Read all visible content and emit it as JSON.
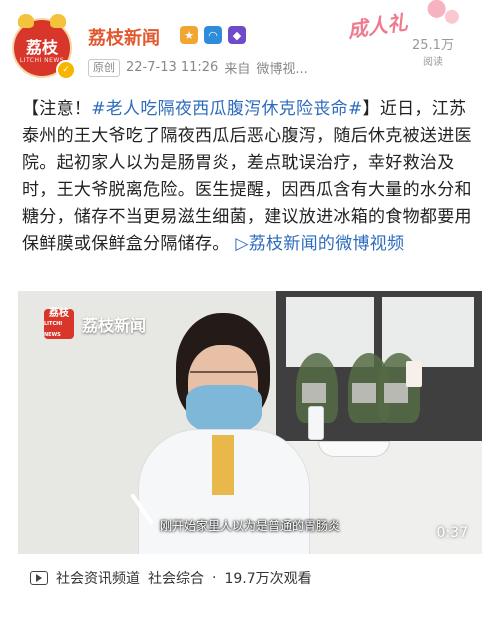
{
  "header": {
    "avatar_text": "荔枝",
    "avatar_sub": "LITCHI NEWS",
    "name": "荔枝新闻",
    "original_badge": "原创",
    "datetime": "22-7-13 11:26",
    "source_prefix": "来自",
    "source": "微博视...",
    "promo": "成人礼",
    "read_count": "25.1万",
    "read_label": "阅读"
  },
  "post": {
    "bracket_open": "【注意！",
    "hashtag": "#老人吃隔夜西瓜腹泻休克险丧命#",
    "bracket_close": "】",
    "body": "近日，江苏泰州的王大爷吃了隔夜西瓜后恶心腹泻，随后休克被送进医院。起初家人以为是肠胃炎，差点耽误治疗，幸好救治及时，王大爷脱离危险。医生提醒，因西瓜含有大量的水分和糖分，储存不当更易滋生细菌，建议放进冰箱的食物都要用保鲜膜或保鲜盒分隔储存。",
    "video_link": "荔枝新闻的微博视频"
  },
  "video": {
    "logo_text": "荔枝新闻",
    "logo_box": "荔枝",
    "logo_box_sub": "LITCHI NEWS",
    "subtitle": "刚开始家里人以为是普通的胃肠炎",
    "duration": "0:37"
  },
  "footer": {
    "channel": "社会资讯频道",
    "category": "社会综合",
    "separator": "·",
    "views": "19.7万次观看"
  },
  "colors": {
    "brand": "#e2592f",
    "link": "#2d6bbd",
    "avatar": "#d9362b"
  }
}
